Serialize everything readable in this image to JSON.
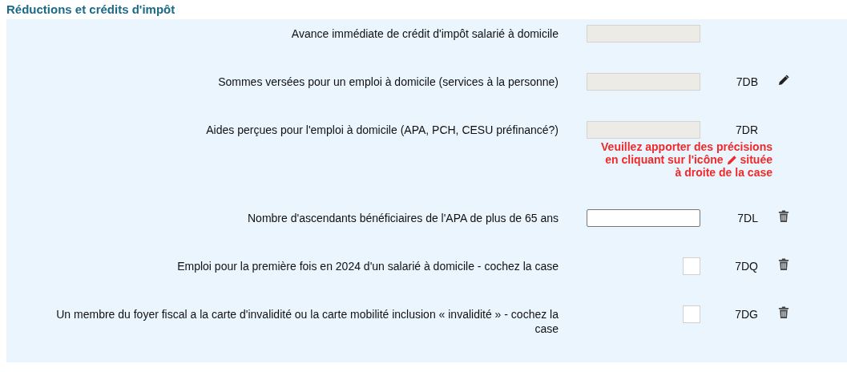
{
  "section_title": "Réductions et crédits d'impôt",
  "rows": [
    {
      "label": "Avance immédiate de crédit d'impôt salarié à domicile",
      "field": {
        "kind": "text",
        "disabled": true
      }
    },
    {
      "label": "Sommes versées pour un emploi à domicile (services à la personne)",
      "code": "7DB",
      "field": {
        "kind": "text",
        "disabled": true
      },
      "icon": {
        "kind": "pencil"
      }
    },
    {
      "label": "Aides perçues pour l'emploi à domicile (APA, PCH, CESU préfinancé?)",
      "code": "7DR",
      "field": {
        "kind": "text",
        "disabled": true
      },
      "error": {
        "line_1": "Veuillez apporter des précisions",
        "line_2_before": "en cliquant sur l'icône",
        "line_2_after": "située",
        "line_3": "à droite de la case"
      }
    },
    {
      "label": "Nombre d'ascendants bénéficiaires de l'APA de plus de 65 ans",
      "code": "7DL",
      "field": {
        "kind": "text",
        "disabled": false
      },
      "icon": {
        "kind": "trash"
      }
    },
    {
      "label": "Emploi pour la première fois en 2024 d'un salarié à domicile - cochez la case",
      "code": "7DQ",
      "field": {
        "kind": "checkbox",
        "checked": false
      },
      "icon": {
        "kind": "trash"
      }
    },
    {
      "label": "Un membre du foyer fiscal a la carte d'invalidité ou la carte mobilité inclusion « invalidité » - cochez la case",
      "code": "7DG",
      "field": {
        "kind": "checkbox",
        "checked": false
      },
      "icon": {
        "kind": "trash"
      }
    }
  ]
}
